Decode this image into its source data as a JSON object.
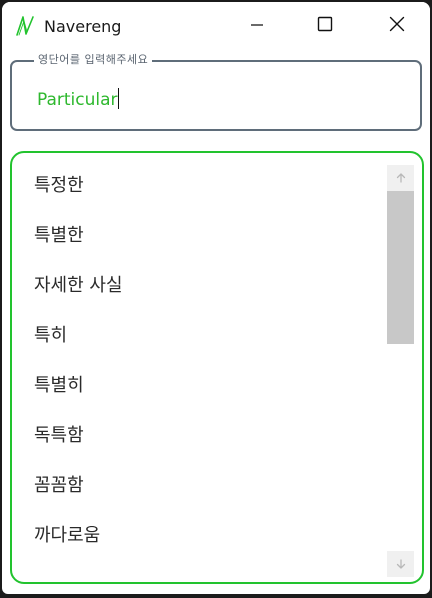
{
  "window": {
    "title": "Navereng",
    "icons": {
      "app": "navereng-logo-icon",
      "minimize": "minimize-icon",
      "maximize": "maximize-icon",
      "close": "close-icon"
    }
  },
  "search": {
    "legend": "영단어를 입력해주세요",
    "value": "Particular"
  },
  "results": {
    "items": [
      "특정한",
      "특별한",
      "자세한 사실",
      "특히",
      "특별히",
      "독특함",
      "꼼꼼함",
      "까다로움"
    ]
  },
  "scrollbar": {
    "up_icon": "arrow-up-icon",
    "down_icon": "arrow-down-icon",
    "position_fraction": 0.0
  },
  "colors": {
    "accent_green": "#22c32e",
    "input_text_green": "#2eb82e",
    "input_border": "#5f6d7a"
  }
}
